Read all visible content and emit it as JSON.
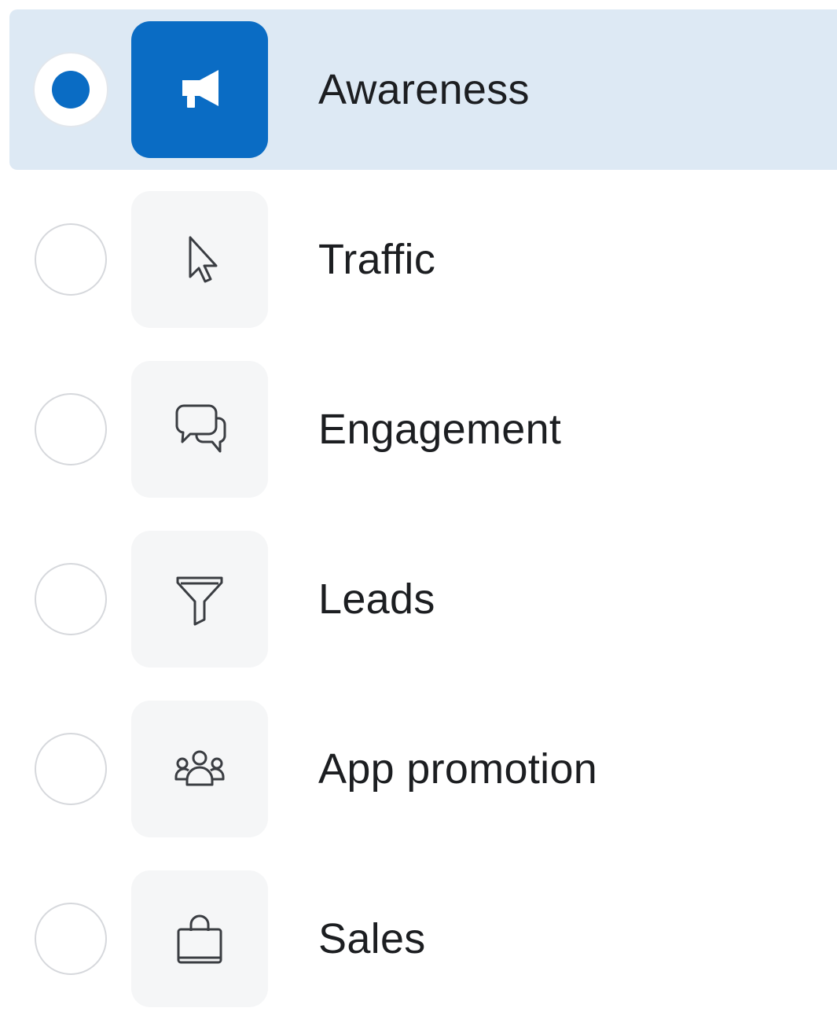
{
  "objectives": [
    {
      "label": "Awareness",
      "icon": "megaphone-icon",
      "selected": true
    },
    {
      "label": "Traffic",
      "icon": "cursor-icon",
      "selected": false
    },
    {
      "label": "Engagement",
      "icon": "chat-bubbles-icon",
      "selected": false
    },
    {
      "label": "Leads",
      "icon": "funnel-icon",
      "selected": false
    },
    {
      "label": "App promotion",
      "icon": "people-icon",
      "selected": false
    },
    {
      "label": "Sales",
      "icon": "shopping-bag-icon",
      "selected": false
    }
  ],
  "colors": {
    "accent": "#0a6cc4",
    "selected_row_bg": "#dde9f4",
    "tile_bg": "#f5f6f7",
    "text": "#1c1e21",
    "icon_stroke": "#3a3d42"
  }
}
